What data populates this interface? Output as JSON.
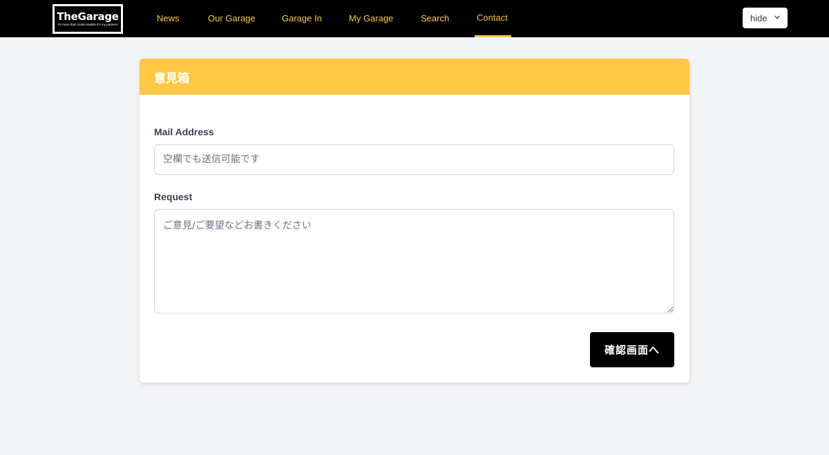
{
  "header": {
    "logo": {
      "title": "TheGarage",
      "tagline": "It's more than Scale Models It's my partners"
    },
    "nav": [
      {
        "label": "News",
        "active": false
      },
      {
        "label": "Our Garage",
        "active": false
      },
      {
        "label": "Garage In",
        "active": false
      },
      {
        "label": "My Garage",
        "active": false
      },
      {
        "label": "Search",
        "active": false
      },
      {
        "label": "Contact",
        "active": true
      }
    ],
    "user_menu": {
      "label": "hide",
      "icon": "chevron-down-icon"
    }
  },
  "form": {
    "title": "意見箱",
    "mail": {
      "label": "Mail Address",
      "value": "",
      "placeholder": "空欄でも送信可能です"
    },
    "request": {
      "label": "Request",
      "value": "",
      "placeholder": "ご意見/ご要望などお書きください"
    },
    "submit_label": "確認画面へ"
  },
  "colors": {
    "header_bg": "#000000",
    "nav_text": "#fbc94a",
    "card_header_bg": "#fec844",
    "page_bg": "#f3f4f6",
    "button_bg": "#000000"
  }
}
